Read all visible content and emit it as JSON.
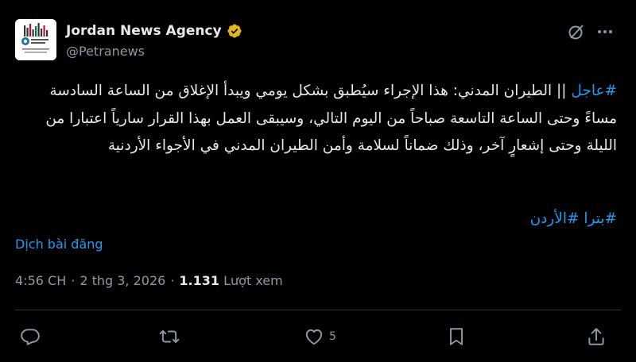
{
  "author": {
    "display_name": "Jordan News Agency",
    "handle": "@Petranews",
    "verified": true,
    "verified_color": "#e2b719",
    "avatar_icon": "petra-logo-icon"
  },
  "header_actions": {
    "grok_icon": "grok-icon",
    "more_icon": "more-icon"
  },
  "post": {
    "hashtag_urgent": "#عاجل",
    "text_main": "|| الطيران المدني:  هذا الإجراء سيُطبق بشكل يومي ويبدأ الإغلاق من الساعة السادسة مساءً وحتى الساعة التاسعة صباحاً من اليوم التالي، وسيبقى العمل بهذا القرار سارياً اعتبارا من الليلة وحتى إشعارٍ آخر، وذلك ضماناً لسلامة وأمن الطيران المدني في الأجواء الأردنية",
    "tag_jordan": "#الأردن",
    "tag_petra": "#بترا",
    "hashtag_color": "#1d9bf0"
  },
  "translate_label": "Dịch bài đăng",
  "meta": {
    "time": "4:56 CH",
    "separator": "·",
    "date": "2 thg 3, 2026",
    "views_count": "1.131",
    "views_label": "Lượt xem"
  },
  "actions": {
    "reply_icon": "reply-icon",
    "repost_icon": "repost-icon",
    "like_icon": "heart-icon",
    "like_count": "5",
    "bookmark_icon": "bookmark-icon",
    "share_icon": "share-icon"
  }
}
